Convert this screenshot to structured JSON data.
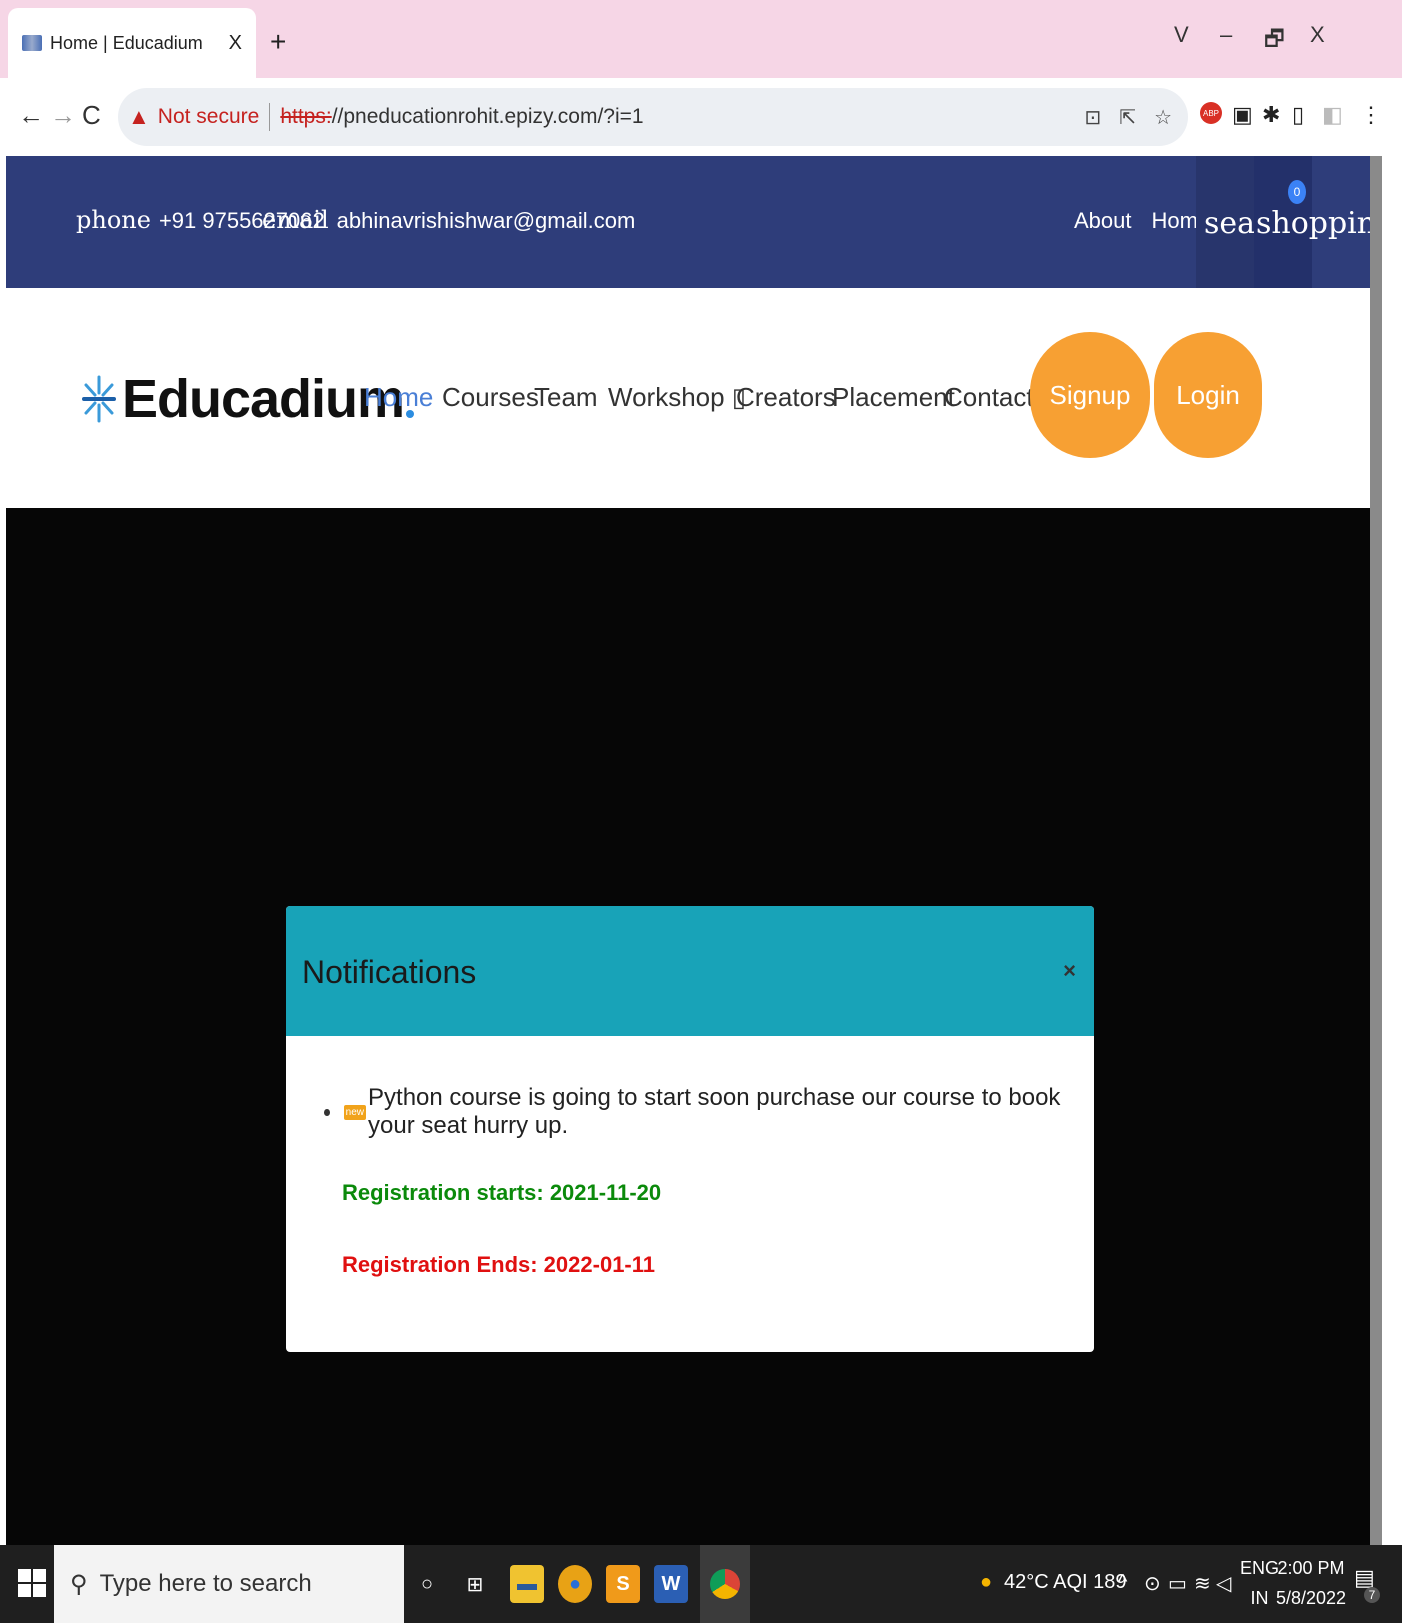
{
  "browser": {
    "tab_title": "Home | Educadium",
    "tab_close": "X",
    "new_tab": "+",
    "window_controls": [
      "V",
      "–",
      "🗗",
      "X"
    ],
    "not_secure": "Not secure",
    "url_scheme": "https:",
    "url_rest": "//pneducationrohit.epizy.com/?i=1",
    "abp_label": "ABP"
  },
  "topbar": {
    "phone_label": "phone",
    "phone_value": "+91 9755627062",
    "email_label": "email",
    "email_value": "abhinavrishishwar@gmail.com",
    "links": [
      "About",
      "Home"
    ],
    "search_text": "search",
    "cart_text": "shopping_cart",
    "cart_count": "0"
  },
  "navbar": {
    "logo_text": "Educadium",
    "menu": [
      "Home",
      "Courses",
      "Team",
      "Workshop ▯",
      "Creators",
      "Placement",
      "Contact"
    ],
    "signup": "Signup",
    "login": "Login"
  },
  "modal": {
    "title": "Notifications",
    "close": "×",
    "new_badge": "new",
    "message": "Python course is going to start soon purchase our course to book your seat hurry up.",
    "reg_start": "Registration starts: 2021-11-20",
    "reg_end": "Registration Ends: 2022-01-11"
  },
  "taskbar": {
    "search_placeholder": "Type here to search",
    "weather": "42°C AQI 189",
    "lang_top": "ENG",
    "lang_bottom": "IN",
    "time": "2:00 PM",
    "date": "5/8/2022",
    "notification_count": "7"
  },
  "colors": {
    "topbar": "#2e3d7a",
    "accent_button": "#f7a033",
    "modal_header": "#18a3b8",
    "reg_start": "#0b8a0b",
    "reg_end": "#e01010"
  }
}
